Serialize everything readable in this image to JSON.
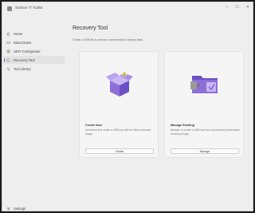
{
  "window": {
    "title": "Surface IT Toolkit",
    "controls": [
      "–",
      "☐",
      "✕"
    ]
  },
  "sidebar": {
    "items": [
      {
        "label": "Home",
        "icon": "home-icon",
        "active": false
      },
      {
        "label": "Data Eraser",
        "icon": "eraser-icon",
        "active": false
      },
      {
        "label": "UEFI Configurator",
        "icon": "uefi-icon",
        "active": false
      },
      {
        "label": "Recovery Tool",
        "icon": "recovery-icon",
        "active": true
      },
      {
        "label": "Tool Library",
        "icon": "library-icon",
        "active": false
      }
    ],
    "settings_label": "Settings"
  },
  "main": {
    "title": "Recovery Tool",
    "description": "Create a USB key to recover a device back to factory state.",
    "cards": [
      {
        "title": "Create New",
        "description": "Download and create a USB key with the latest recovery image.",
        "button": "Create",
        "icon": "box-download-icon"
      },
      {
        "title": "Manage Existing",
        "description": "Manage or create a USB key from a previously downloaded recovery image.",
        "button": "Manage",
        "icon": "folder-usb-icon"
      }
    ]
  },
  "colors": {
    "accent": "#6b4fc7",
    "window_bg": "#eeeeee",
    "card_bg": "#f5f5f5"
  }
}
